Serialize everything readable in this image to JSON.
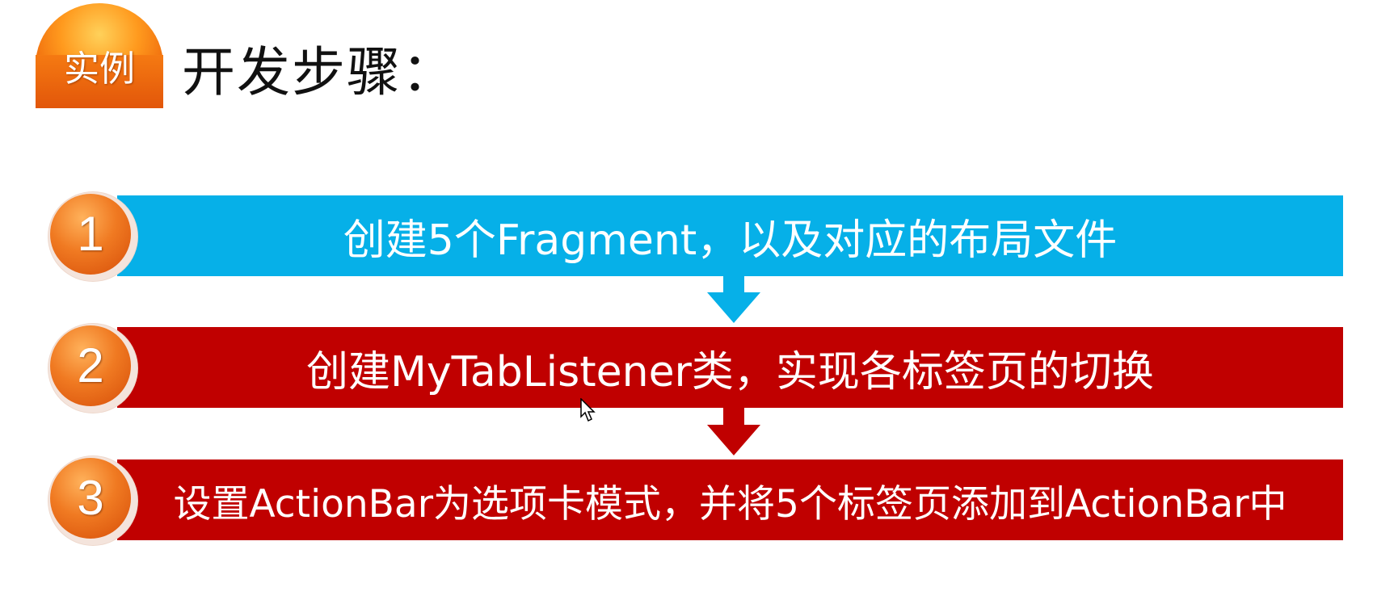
{
  "header": {
    "badge_label": "实例",
    "title": "开发步骤："
  },
  "steps": [
    {
      "number": "1",
      "text": "创建5个Fragment，以及对应的布局文件",
      "color": "#06b0e8"
    },
    {
      "number": "2",
      "text": "创建MyTabListener类，实现各标签页的切换",
      "color": "#c00000"
    },
    {
      "number": "3",
      "text": "设置ActionBar为选项卡模式，并将5个标签页添加到ActionBar中",
      "color": "#c00000"
    }
  ],
  "colors": {
    "accent_orange": "#f07a22",
    "step_blue": "#06b0e8",
    "step_red": "#c00000"
  },
  "icons": {
    "arrow": "arrow-down-icon",
    "pointer": "mouse-pointer-icon"
  }
}
